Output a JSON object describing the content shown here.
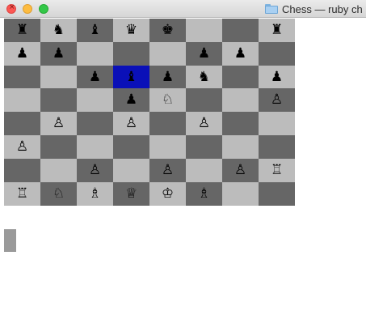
{
  "window": {
    "title": "Chess — ruby ch"
  },
  "board": {
    "selected": [
      2,
      3
    ],
    "light_color": "#bcbcbc",
    "dark_color": "#666666",
    "selected_color": "#0a10b8",
    "rows": [
      [
        "♜",
        "♞",
        "♝",
        "♛",
        "♚",
        "",
        "",
        "♜"
      ],
      [
        "♟",
        "♟",
        "",
        "",
        "",
        "♟",
        "♟",
        ""
      ],
      [
        "",
        "",
        "♟",
        "♝",
        "♟",
        "♞",
        "",
        "♟"
      ],
      [
        "",
        "",
        "",
        "♟",
        "♘",
        "",
        "",
        "♙"
      ],
      [
        "",
        "♙",
        "",
        "♙",
        "",
        "♙",
        "",
        ""
      ],
      [
        "♙",
        "",
        "",
        "",
        "",
        "",
        "",
        ""
      ],
      [
        "",
        "",
        "♙",
        "",
        "♙",
        "",
        "♙",
        "♖"
      ],
      [
        "♖",
        "♘",
        "♗",
        "♕",
        "♔",
        "♗",
        "",
        ""
      ]
    ]
  }
}
